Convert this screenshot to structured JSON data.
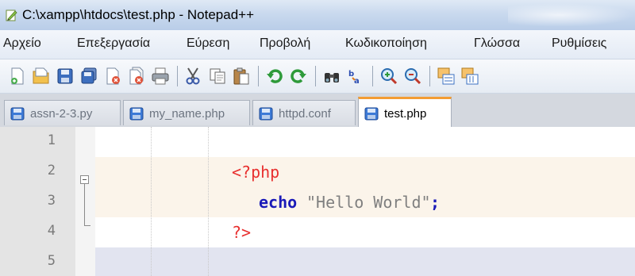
{
  "window": {
    "title": "C:\\xampp\\htdocs\\test.php - Notepad++"
  },
  "menu": {
    "items": [
      "Αρχείο",
      "Επεξεργασία",
      "Εύρεση",
      "Προβολή",
      "Κωδικοποίηση",
      "Γλώσσα",
      "Ρυθμίσεις"
    ]
  },
  "toolbar": {
    "icons": [
      "new-file-icon",
      "open-file-icon",
      "save-icon",
      "save-all-icon",
      "close-icon",
      "close-all-icon",
      "print-icon",
      "cut-icon",
      "copy-icon",
      "paste-icon",
      "undo-icon",
      "redo-icon",
      "find-icon",
      "replace-icon",
      "zoom-in-icon",
      "zoom-out-icon",
      "sync-vertical-icon",
      "sync-horizontal-icon"
    ]
  },
  "tabs": [
    {
      "label": "assn-2-3.py",
      "active": false
    },
    {
      "label": "my_name.php",
      "active": false
    },
    {
      "label": "httpd.conf",
      "active": false
    },
    {
      "label": "test.php",
      "active": true
    }
  ],
  "editor": {
    "line_numbers": [
      "1",
      "2",
      "3",
      "4",
      "5"
    ],
    "lines": [
      {
        "text": "",
        "tokens": []
      },
      {
        "text": "<?php",
        "tokens": [
          {
            "t": "<?php",
            "c": "php-tag"
          }
        ]
      },
      {
        "text": "  echo \"Hello World\";",
        "tokens": [
          {
            "t": "echo",
            "c": "keyword"
          },
          {
            "t": "\"Hello World\"",
            "c": "string"
          },
          {
            "t": ";",
            "c": "operator"
          }
        ]
      },
      {
        "text": "?>",
        "tokens": [
          {
            "t": "?>",
            "c": "php-tag"
          }
        ]
      },
      {
        "text": "",
        "tokens": []
      }
    ],
    "colors": {
      "php_tag": "#e8302f",
      "keyword": "#1a1ab8",
      "string": "#7f7f7f",
      "operator": "#1a1ab8",
      "current_line": "#e2e4f0",
      "tab_accent": "#f39c33"
    }
  }
}
